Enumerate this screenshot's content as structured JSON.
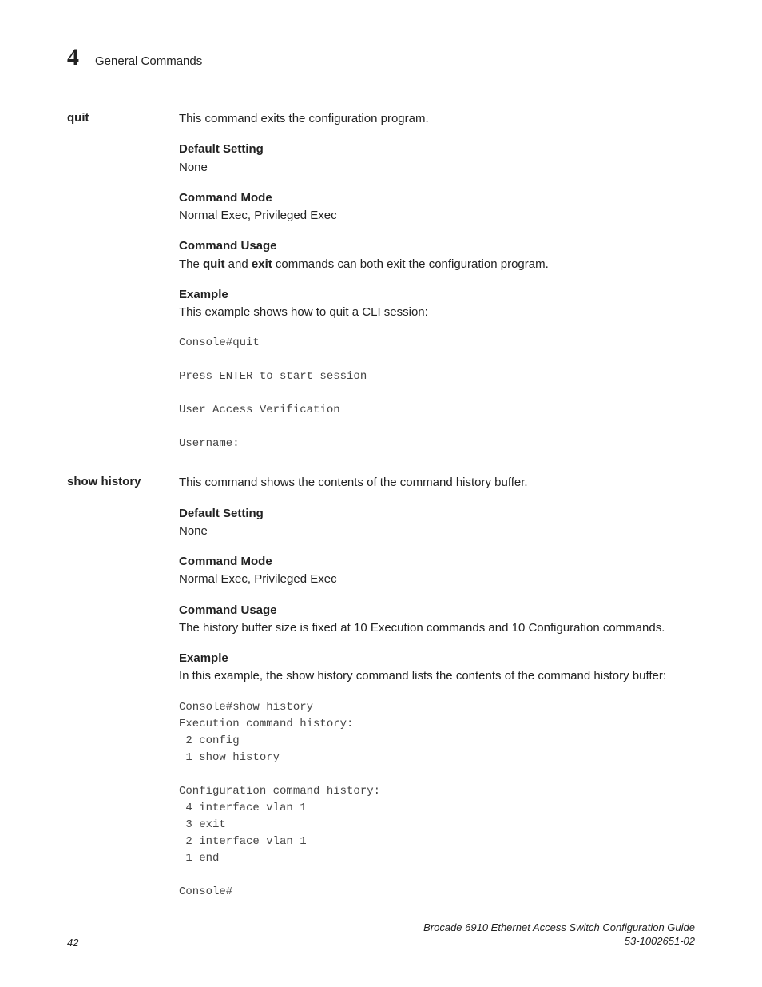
{
  "header": {
    "chapter_num": "4",
    "chapter_title": "General Commands"
  },
  "sections": {
    "quit": {
      "label": "quit",
      "intro": "This command exits the configuration program.",
      "default_setting_h": "Default Setting",
      "default_setting_v": "None",
      "command_mode_h": "Command Mode",
      "command_mode_v": "Normal Exec, Privileged Exec",
      "command_usage_h": "Command Usage",
      "command_usage_pre": "The ",
      "command_usage_b1": "quit",
      "command_usage_mid": " and ",
      "command_usage_b2": "exit",
      "command_usage_post": " commands can both exit the configuration program.",
      "example_h": "Example",
      "example_intro": "This example shows how to quit a CLI session:",
      "example_code": "Console#quit\n\nPress ENTER to start session\n\nUser Access Verification\n\nUsername:"
    },
    "show_history": {
      "label": "show history",
      "intro": "This command shows the contents of the command history buffer.",
      "default_setting_h": "Default Setting",
      "default_setting_v": "None",
      "command_mode_h": "Command Mode",
      "command_mode_v": "Normal Exec, Privileged Exec",
      "command_usage_h": "Command Usage",
      "command_usage_v": "The history buffer size is fixed at 10 Execution commands and 10 Configuration commands.",
      "example_h": "Example",
      "example_intro": "In this example, the show history command lists the contents of the command history buffer:",
      "example_code": "Console#show history\nExecution command history:\n 2 config\n 1 show history\n\nConfiguration command history:\n 4 interface vlan 1\n 3 exit\n 2 interface vlan 1\n 1 end\n\nConsole#"
    }
  },
  "footer": {
    "page_num": "42",
    "doc_title": "Brocade 6910 Ethernet Access Switch Configuration Guide",
    "doc_id": "53-1002651-02"
  }
}
